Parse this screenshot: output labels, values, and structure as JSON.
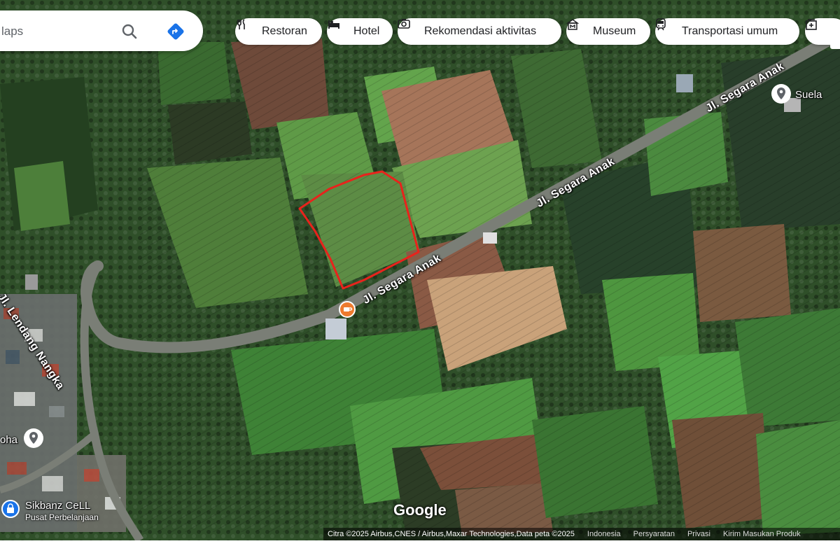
{
  "search": {
    "placeholder": "laps"
  },
  "chips": [
    {
      "label": "Restoran",
      "icon": "fork-knife-icon"
    },
    {
      "label": "Hotel",
      "icon": "bed-icon"
    },
    {
      "label": "Rekomendasi aktivitas",
      "icon": "camera-icon"
    },
    {
      "label": "Museum",
      "icon": "museum-icon"
    },
    {
      "label": "Transportasi umum",
      "icon": "train-icon"
    },
    {
      "label": "",
      "icon": "pharmacy-icon"
    }
  ],
  "streets": {
    "segara_1": "Jl. Segara Anak",
    "segara_2": "Jl. Segara Anak",
    "segara_3": "Jl. Segara Anak",
    "lendang": "Jl. Lendang Nangka"
  },
  "places": {
    "suela": "Suela",
    "doha": "oha",
    "sikbanz": "Sikbanz CeLL",
    "sikbanz_sub": "Pusat Perbelanjaan"
  },
  "map_brand": "Google",
  "attribution": {
    "credit": "Citra ©2025 Airbus,CNES / Airbus,Maxar Technologies,Data peta ©2025",
    "country": "Indonesia",
    "terms": "Persyaratan",
    "privacy": "Privasi",
    "feedback": "Kirim Masukan Produk"
  },
  "colors": {
    "annotation_outline": "#e8231c",
    "cafe_marker": "#ee7a2e",
    "shopping_marker": "#1a73e8",
    "directions_blue": "#1a73e8"
  }
}
